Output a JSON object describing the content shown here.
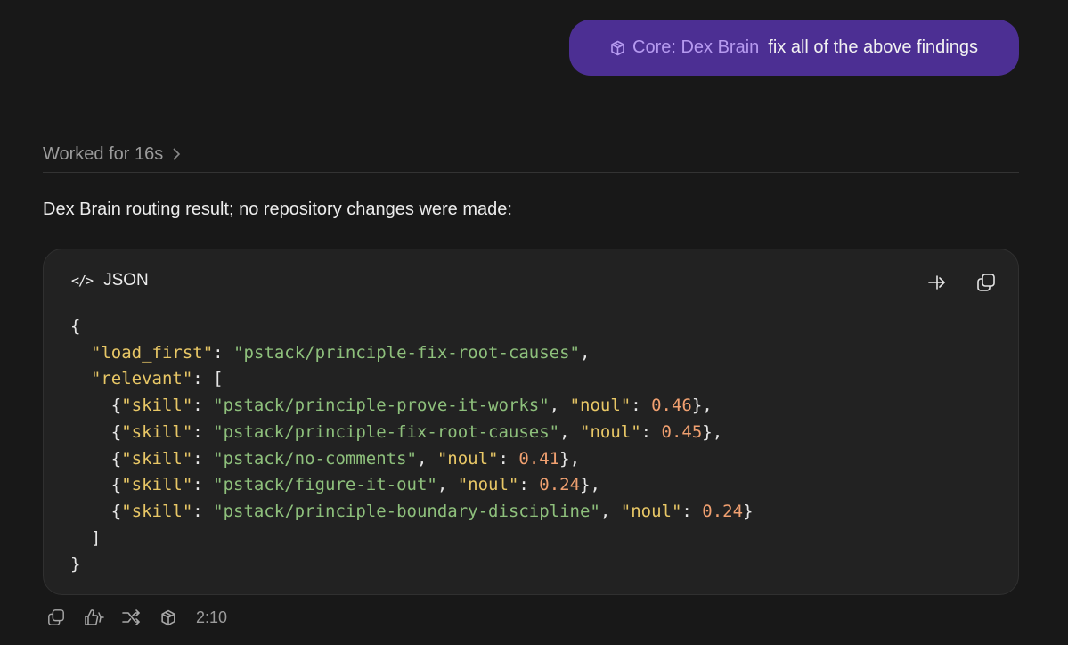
{
  "user_message": {
    "chip_label": "Core: Dex Brain",
    "text": "fix all of the above findings"
  },
  "worked": {
    "label": "Worked for 16s"
  },
  "answer": {
    "text": "Dex Brain routing result; no repository changes were made:"
  },
  "code_block": {
    "language": "JSON",
    "lines": [
      [
        {
          "t": "p",
          "v": "{"
        }
      ],
      [
        {
          "t": "p",
          "v": "  "
        },
        {
          "t": "k",
          "v": "\"load_first\""
        },
        {
          "t": "p",
          "v": ": "
        },
        {
          "t": "s",
          "v": "\"pstack/principle-fix-root-causes\""
        },
        {
          "t": "p",
          "v": ","
        }
      ],
      [
        {
          "t": "p",
          "v": "  "
        },
        {
          "t": "k",
          "v": "\"relevant\""
        },
        {
          "t": "p",
          "v": ": ["
        }
      ],
      [
        {
          "t": "p",
          "v": "    {"
        },
        {
          "t": "k",
          "v": "\"skill\""
        },
        {
          "t": "p",
          "v": ": "
        },
        {
          "t": "s",
          "v": "\"pstack/principle-prove-it-works\""
        },
        {
          "t": "p",
          "v": ", "
        },
        {
          "t": "k",
          "v": "\"noul\""
        },
        {
          "t": "p",
          "v": ": "
        },
        {
          "t": "n",
          "v": "0.46"
        },
        {
          "t": "p",
          "v": "},"
        }
      ],
      [
        {
          "t": "p",
          "v": "    {"
        },
        {
          "t": "k",
          "v": "\"skill\""
        },
        {
          "t": "p",
          "v": ": "
        },
        {
          "t": "s",
          "v": "\"pstack/principle-fix-root-causes\""
        },
        {
          "t": "p",
          "v": ", "
        },
        {
          "t": "k",
          "v": "\"noul\""
        },
        {
          "t": "p",
          "v": ": "
        },
        {
          "t": "n",
          "v": "0.45"
        },
        {
          "t": "p",
          "v": "},"
        }
      ],
      [
        {
          "t": "p",
          "v": "    {"
        },
        {
          "t": "k",
          "v": "\"skill\""
        },
        {
          "t": "p",
          "v": ": "
        },
        {
          "t": "s",
          "v": "\"pstack/no-comments\""
        },
        {
          "t": "p",
          "v": ", "
        },
        {
          "t": "k",
          "v": "\"noul\""
        },
        {
          "t": "p",
          "v": ": "
        },
        {
          "t": "n",
          "v": "0.41"
        },
        {
          "t": "p",
          "v": "},"
        }
      ],
      [
        {
          "t": "p",
          "v": "    {"
        },
        {
          "t": "k",
          "v": "\"skill\""
        },
        {
          "t": "p",
          "v": ": "
        },
        {
          "t": "s",
          "v": "\"pstack/figure-it-out\""
        },
        {
          "t": "p",
          "v": ", "
        },
        {
          "t": "k",
          "v": "\"noul\""
        },
        {
          "t": "p",
          "v": ": "
        },
        {
          "t": "n",
          "v": "0.24"
        },
        {
          "t": "p",
          "v": "},"
        }
      ],
      [
        {
          "t": "p",
          "v": "    {"
        },
        {
          "t": "k",
          "v": "\"skill\""
        },
        {
          "t": "p",
          "v": ": "
        },
        {
          "t": "s",
          "v": "\"pstack/principle-boundary-discipline\""
        },
        {
          "t": "p",
          "v": ", "
        },
        {
          "t": "k",
          "v": "\"noul\""
        },
        {
          "t": "p",
          "v": ": "
        },
        {
          "t": "n",
          "v": "0.24"
        },
        {
          "t": "p",
          "v": "}"
        }
      ],
      [
        {
          "t": "p",
          "v": "  ]"
        }
      ],
      [
        {
          "t": "p",
          "v": "}"
        }
      ]
    ]
  },
  "footer": {
    "timestamp": "2:10"
  },
  "colors": {
    "background": "#181818",
    "user_bubble": "#4c2f93",
    "chip_text": "#b69af0",
    "code_key": "#e8c766",
    "code_string": "#8ec07c",
    "code_number": "#f0a070"
  },
  "icons": [
    "cube-icon",
    "chevron-right-icon",
    "code-icon",
    "wrap-icon",
    "copy-icon",
    "thumbs-icon",
    "branch-icon"
  ]
}
